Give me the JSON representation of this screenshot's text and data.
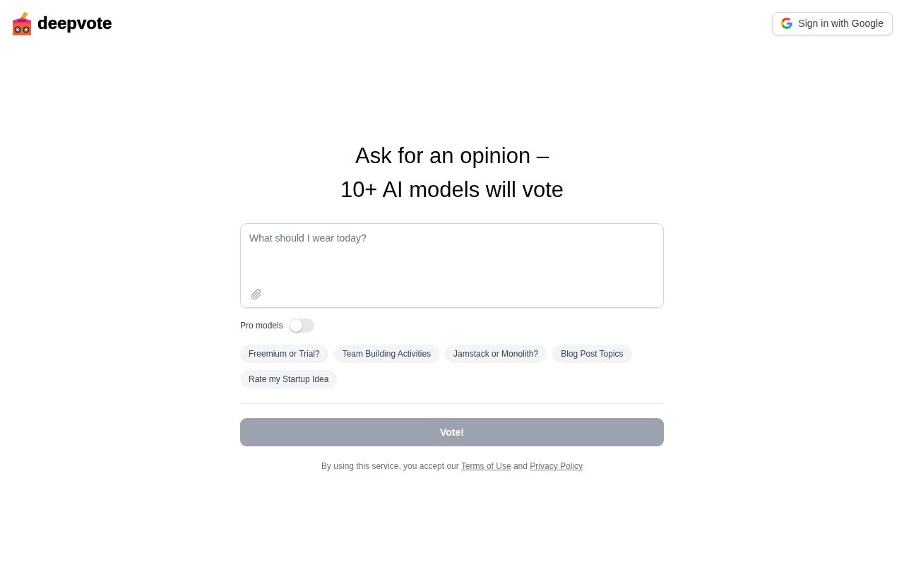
{
  "header": {
    "brand": "deepvote",
    "sign_in": "Sign in with Google"
  },
  "hero": {
    "title_lines": [
      "Ask for an opinion –",
      "10+ AI models will vote"
    ]
  },
  "prompt": {
    "placeholder": "What should I wear today?"
  },
  "pro_models": {
    "label": "Pro models",
    "on": false
  },
  "suggestions": [
    "Freemium or Trial?",
    "Team Building Activities",
    "Jamstack or Monolith?",
    "Blog Post Topics",
    "Rate my Startup Idea"
  ],
  "vote_button": {
    "label": "Vote!",
    "disabled": true
  },
  "legal": {
    "parts": [
      {
        "kind": "text",
        "text": "By using this service, you accept our "
      },
      {
        "kind": "link",
        "text": "Terms of Use"
      },
      {
        "kind": "text",
        "text": " and "
      },
      {
        "kind": "link",
        "text": "Privacy Policy"
      }
    ]
  }
}
